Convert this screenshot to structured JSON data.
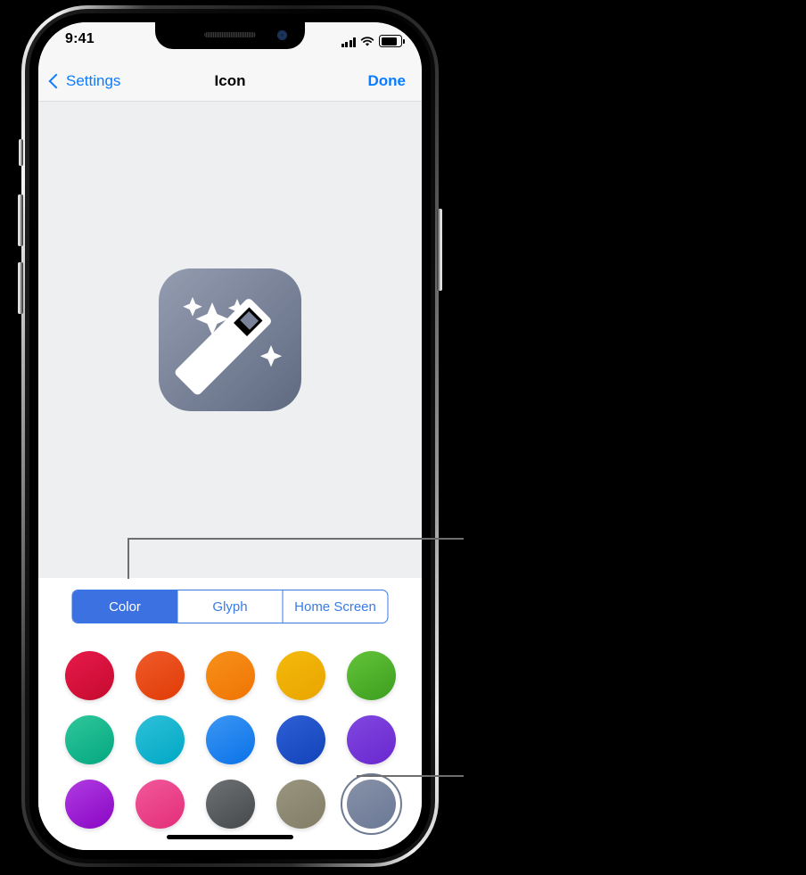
{
  "device": {
    "status_bar": {
      "time": "9:41",
      "cellular_icon": "signal-bars-icon",
      "wifi_icon": "wifi-icon",
      "battery_icon": "battery-icon"
    },
    "home_indicator": "home-indicator"
  },
  "nav": {
    "back_label": "Settings",
    "back_icon": "chevron-left-icon",
    "title": "Icon",
    "done_label": "Done"
  },
  "preview": {
    "icon_name": "magic-wand-icon",
    "icon_gradient_from": "#949cb0",
    "icon_gradient_to": "#5f6a81",
    "background": "#edeff0"
  },
  "segmented_control": {
    "selected": "Color",
    "accent": "#3b71e0",
    "segments": [
      {
        "label": "Color",
        "selected": true
      },
      {
        "label": "Glyph",
        "selected": false
      },
      {
        "label": "Home Screen",
        "selected": false
      }
    ]
  },
  "color_swatches": {
    "selected_index": 14,
    "rows": [
      [
        {
          "name": "crimson",
          "from": "#e8194b",
          "to": "#c40b2e"
        },
        {
          "name": "red-orange",
          "from": "#f05a2a",
          "to": "#e03c06"
        },
        {
          "name": "orange",
          "from": "#f7911b",
          "to": "#ef7403"
        },
        {
          "name": "amber",
          "from": "#f4b90a",
          "to": "#e9a500"
        },
        {
          "name": "green",
          "from": "#63c339",
          "to": "#3d9e1f"
        }
      ],
      [
        {
          "name": "teal-green",
          "from": "#2fc79a",
          "to": "#04a781"
        },
        {
          "name": "cyan",
          "from": "#2ec0d9",
          "to": "#00a8c4"
        },
        {
          "name": "light-blue",
          "from": "#3c96f4",
          "to": "#0a72e8"
        },
        {
          "name": "dark-blue",
          "from": "#2d5fd6",
          "to": "#1343b8"
        },
        {
          "name": "purple",
          "from": "#8048e0",
          "to": "#6a27cf"
        }
      ],
      [
        {
          "name": "violet",
          "from": "#b03ce2",
          "to": "#8a06c4"
        },
        {
          "name": "pink",
          "from": "#f2589b",
          "to": "#e22e79"
        },
        {
          "name": "dark-gray",
          "from": "#6e7174",
          "to": "#46494c"
        },
        {
          "name": "khaki",
          "from": "#9a957f",
          "to": "#817d66"
        },
        {
          "name": "slate-blue",
          "from": "#8792a8",
          "to": "#6b7896"
        }
      ]
    ]
  },
  "callouts": [
    {
      "name": "callout-segmented-control"
    },
    {
      "name": "callout-selected-color"
    }
  ]
}
